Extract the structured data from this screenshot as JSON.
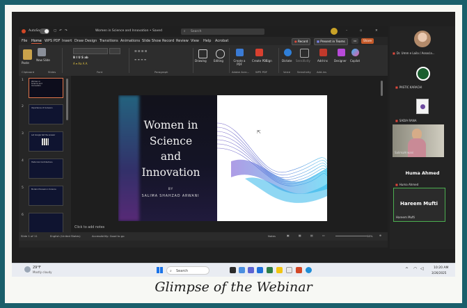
{
  "caption": "Glimpse of the Webinar",
  "titlebar": {
    "autosave": "AutoSave",
    "doc_title": "Women in Science and Innovation • Saved",
    "search_placeholder": "Search"
  },
  "menu": {
    "tabs": [
      "File",
      "Home",
      "WPS PDF",
      "Insert",
      "Draw",
      "Design",
      "Transitions",
      "Animations",
      "Slide Show",
      "Record",
      "Review",
      "View",
      "Help",
      "Acrobat"
    ],
    "active": "Home",
    "record_btn": "Record",
    "present_btn": "Present in Teams",
    "share_btn": "Share"
  },
  "ribbon": {
    "paste": "Paste",
    "new_slide": "New Slide",
    "groups": [
      "Clipboard",
      "Slides",
      "Font",
      "Paragraph",
      "Adobe Acro...",
      "WPS PDF",
      "Voice",
      "Sensitivity",
      "Add-ins"
    ],
    "buttons": [
      "Drawing",
      "Editing",
      "Create a PDF",
      "Create PDF",
      "Sign",
      "Dictate",
      "Sensitivity",
      "Add-ins",
      "Designer",
      "Copilot"
    ]
  },
  "thumbnails": [
    {
      "num": "1",
      "text": "Women in Science and Innovation"
    },
    {
      "num": "2",
      "text": "Importance of Inclusion"
    },
    {
      "num": "3",
      "text": "Let Google tell the answer"
    },
    {
      "num": "4",
      "text": "Historical Contributions"
    },
    {
      "num": "5",
      "text": "Modern Pioneers in Science"
    },
    {
      "num": "6",
      "text": ""
    }
  ],
  "slide": {
    "title_lines": [
      "Women in",
      "Science",
      "and",
      "Innovation"
    ],
    "by": "BY",
    "author": "SALIMA SHAHZAD ARWANI"
  },
  "notes_placeholder": "Click to add notes",
  "statusbar": {
    "slide_count": "Slide 1 of 11",
    "language": "English (United States)",
    "accessibility": "Accessibility: Good to go",
    "notes": "Notes",
    "zoom": "58%"
  },
  "participants": [
    {
      "label": "Dr. Umm e Laila / Associa..."
    },
    {
      "label": "PASTIC KARACHI"
    },
    {
      "label": "SADIA RANA"
    },
    {
      "label": "SalimaArwani"
    },
    {
      "label": "Huma Ahmed",
      "big": "Huma Ahmed"
    },
    {
      "label": "Hareem Mufti",
      "big": "Hareem Mufti"
    }
  ],
  "taskbar": {
    "temperature": "29°F",
    "weather": "Mostly cloudy",
    "search": "Search",
    "time": "10:20 AM",
    "date": "3/26/2025"
  },
  "colors": {
    "frame": "#1a5f6b",
    "accent_orange": "#d85a3a",
    "speaker_border": "#4caf50"
  }
}
